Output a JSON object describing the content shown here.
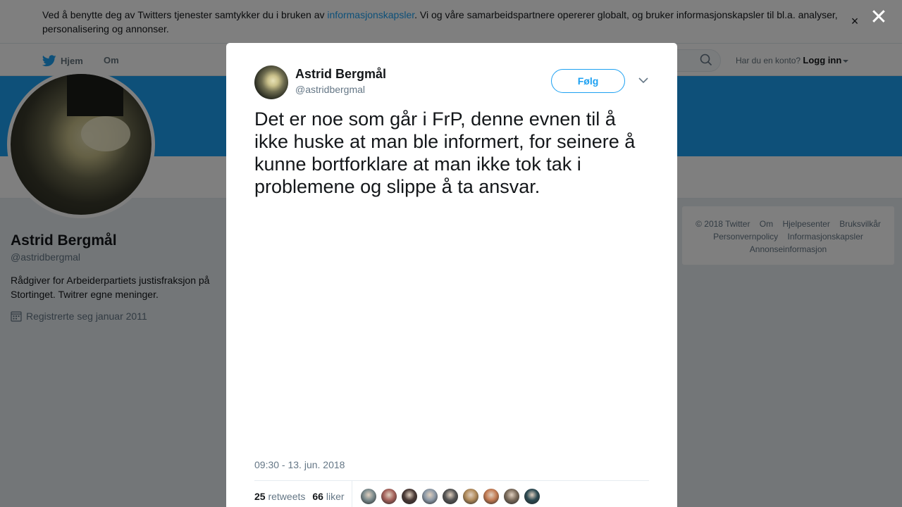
{
  "cookie_banner": {
    "text_before": "Ved å benytte deg av Twitters tjenester samtykker du i bruken av ",
    "link": "informasjonskapsler",
    "text_after": ". Vi og våre samarbeidspartnere opererer globalt, og bruker informasjonskapsler til bl.a. analyser, personalisering og annonser.",
    "close_glyph": "×"
  },
  "nav": {
    "home_label": "Hjem",
    "about_label": "Om",
    "login_prompt": "Har du en konto?",
    "login_link": "Logg inn"
  },
  "profile": {
    "name": "Astrid Bergmål",
    "handle": "@astridbergmal",
    "bio": "Rådgiver for Arbeiderpartiets justisfraksjon på Stortinget. Twitrer egne meninger.",
    "joined": "Registrerte seg januar 2011"
  },
  "footer": {
    "links": [
      "© 2018 Twitter",
      "Om",
      "Hjelpesenter",
      "Bruksvilkår",
      "Personvernpolicy",
      "Informasjonskapsler",
      "Annonseinformasjon"
    ]
  },
  "overlay": {
    "close_glyph": "✕"
  },
  "tweet": {
    "author_name": "Astrid Bergmål",
    "author_handle": "@astridbergmal",
    "follow_label": "Følg",
    "text": "Det er noe som går i FrP, denne evnen til å ikke huske at man ble informert, for seinere å kunne bortforklare at man ikke tok tak i problemene og slippe å ta ansvar.",
    "timestamp": "09:30 - 13. jun. 2018",
    "retweets_count": "25",
    "retweets_label": "retweets",
    "likes_count": "66",
    "likes_label": "liker",
    "liker_colors": [
      "#7a8a8c",
      "#a4615a",
      "#4a3a36",
      "#8b98a6",
      "#555555",
      "#b08a5a",
      "#c27a52",
      "#7a6a5a",
      "#2d4a52"
    ]
  },
  "colors": {
    "accent": "#1da1f2",
    "text": "#14171a",
    "muted": "#657786"
  }
}
